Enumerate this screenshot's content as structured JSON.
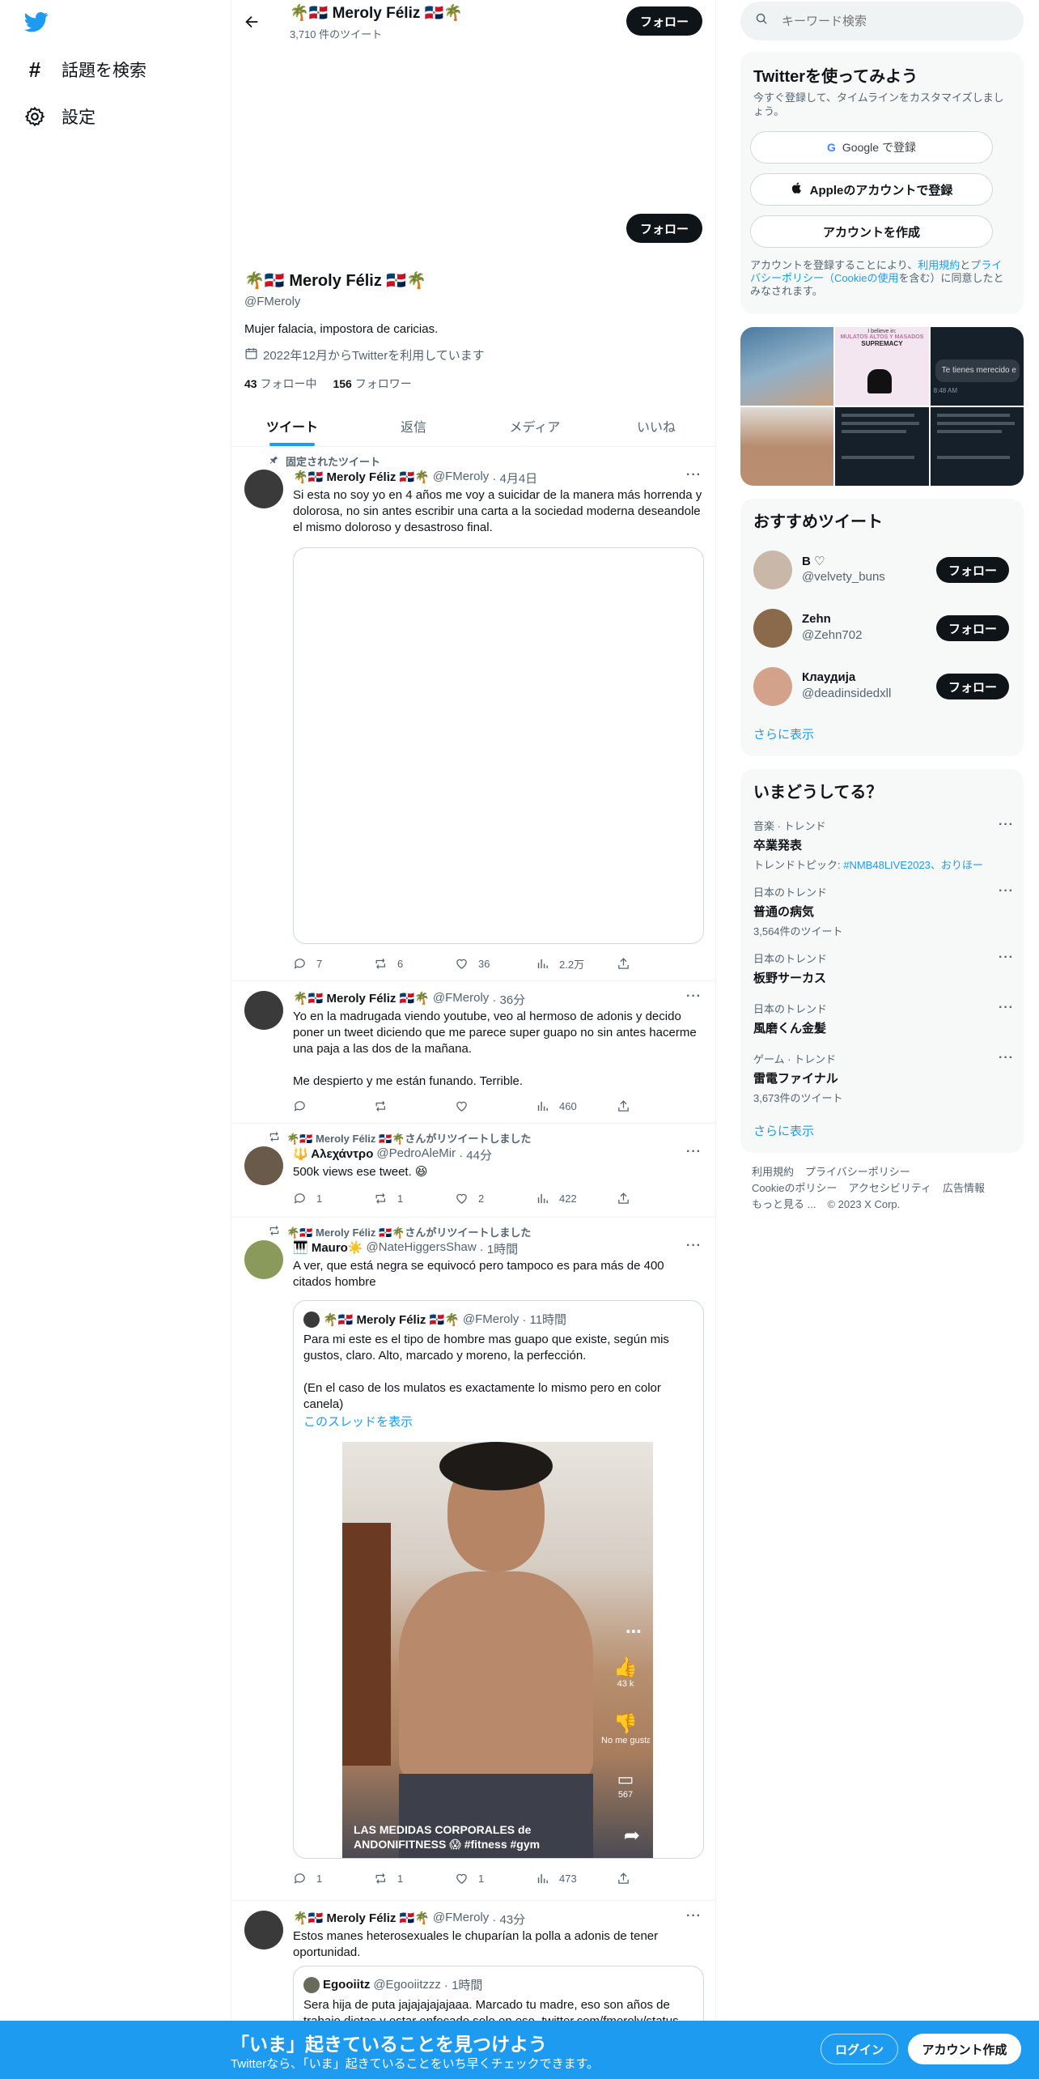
{
  "nav": {
    "explore_label": "話題を検索",
    "settings_label": "設定"
  },
  "header": {
    "name": "🌴🇩🇴 Meroly Féliz 🇩🇴🌴",
    "tweet_count": "3,710 件のツイート",
    "follow_label": "フォロー"
  },
  "profile": {
    "follow_label": "フォロー",
    "name": "🌴🇩🇴 Meroly Féliz 🇩🇴🌴",
    "handle": "@FMeroly",
    "bio": "Mujer falacia, impostora de caricias.",
    "joined": "2022年12月からTwitterを利用しています",
    "following_count": "43",
    "following_label": "フォロー中",
    "followers_count": "156",
    "followers_label": "フォロワー"
  },
  "tabs": [
    "ツイート",
    "返信",
    "メディア",
    "いいね"
  ],
  "tweets": [
    {
      "pinned_label": "固定されたツイート",
      "name": "🌴🇩🇴 Meroly Féliz 🇩🇴🌴",
      "handle": "@FMeroly",
      "time": "· 4月4日",
      "text": "Si esta no soy yo en 4 años me voy a suicidar de la manera más horrenda y dolorosa, no sin antes escribir una carta a la sociedad moderna deseandole el mismo doloroso y desastroso final.",
      "replies": "7",
      "retweets": "6",
      "likes": "36",
      "views": "2.2万"
    },
    {
      "name": "🌴🇩🇴 Meroly Féliz 🇩🇴🌴",
      "handle": "@FMeroly",
      "time": "· 36分",
      "text": "Yo en la madrugada viendo youtube, veo al hermoso de adonis y decido poner un tweet diciendo que me parece super guapo no sin antes hacerme una paja a las dos de la mañana.\n\nMe despierto y me están funando. Terrible.",
      "replies": "",
      "retweets": "",
      "likes": "",
      "views": "460"
    },
    {
      "retweet_label": "🌴🇩🇴 Meroly Féliz 🇩🇴🌴さんがリツイートしました",
      "name": "🔱 Αλεχάντρο",
      "handle": "@PedroAleMir",
      "time": "· 44分",
      "text": "500k views ese tweet. 😆",
      "replies": "1",
      "retweets": "1",
      "likes": "2",
      "views": "422"
    },
    {
      "retweet_label": "🌴🇩🇴 Meroly Féliz 🇩🇴🌴さんがリツイートしました",
      "name": "🎹 Mauro☀️",
      "handle": "@NateHiggersShaw",
      "time": "· 1時間",
      "text": "A ver, que está negra se equivocó pero tampoco es para más de 400 citados hombre",
      "quote_name": "🌴🇩🇴 Meroly Féliz 🇩🇴🌴",
      "quote_handle": "@FMeroly",
      "quote_time": "· 11時間",
      "quote_text": "Para mi este es el tipo de hombre mas guapo que existe, según mis gustos, claro. Alto, marcado y moreno, la perfección.\n\n(En el caso de los mulatos es exactamente lo mismo pero en color canela)",
      "show_thread": "このスレッドを表示",
      "video_caption": "LAS MEDIDAS CORPORALES de ANDONIFITNESS 😱 #fitness #gym",
      "video_likes": "43 k",
      "video_dislike": "No me gusta",
      "video_comments": "567",
      "replies": "1",
      "retweets": "1",
      "likes": "1",
      "views": "473"
    },
    {
      "name": "🌴🇩🇴 Meroly Féliz 🇩🇴🌴",
      "handle": "@FMeroly",
      "time": "· 43分",
      "text": "Estos manes heterosexuales le chuparían la polla a adonis de tener oportunidad.",
      "quote_name": "Egooiitz",
      "quote_handle": "@Egooiitzzz",
      "quote_time": "· 1時間",
      "quote_text": "Sera hija de puta jajajajajajaaa. Marcado tu madre, eso son años de trabajo dietas y estar enfocado solo en eso. twitter.com/fmeroly/status..."
    }
  ],
  "sidebar": {
    "search_placeholder": "キーワード検索",
    "signup": {
      "title": "Twitterを使ってみよう",
      "subtitle": "今すぐ登録して、タイムラインをカスタマイズしましょう。",
      "google_label": "Google で登録",
      "apple_label": "Appleのアカウントで登録",
      "create_label": "アカウントを作成",
      "terms_pre": "アカウントを登録することにより、",
      "terms_link1": "利用規約",
      "terms_mid": "と",
      "terms_link2": "プライバシーポリシー（Cookieの使用",
      "terms_post": "を含む）に同意したとみなされます。"
    },
    "media_texts": {
      "m2_top": "I believe in:",
      "m2_mid": "MULATOS ALTOS Y MASADOS",
      "m2_bottom": "SUPREMACY",
      "m3_text": "Te tienes merecido e",
      "m3_time": "8:48 AM"
    },
    "suggested": {
      "title": "おすすめツイート",
      "users": [
        {
          "name": "B ♡",
          "handle": "@velvety_buns",
          "follow": "フォロー"
        },
        {
          "name": "Zehn",
          "handle": "@Zehn702",
          "follow": "フォロー"
        },
        {
          "name": "Клаудија",
          "handle": "@deadinsidedxll",
          "follow": "フォロー"
        }
      ],
      "more": "さらに表示"
    },
    "trends": {
      "title": "いまどうしてる？",
      "items": [
        {
          "category": "音楽 · トレンド",
          "name": "卒業発表",
          "sub": "トレンドトピック: #NMB48LIVE2023、おりほー"
        },
        {
          "category": "日本のトレンド",
          "name": "普通の病気",
          "sub": "3,564件のツイート"
        },
        {
          "category": "日本のトレンド",
          "name": "板野サーカス",
          "sub": ""
        },
        {
          "category": "日本のトレンド",
          "name": "風磨くん金髪",
          "sub": ""
        },
        {
          "category": "ゲーム · トレンド",
          "name": "雷電ファイナル",
          "sub": "3,673件のツイート"
        }
      ],
      "more": "さらに表示"
    },
    "footer": {
      "terms": "利用規約",
      "privacy": "プライバシーポリシー",
      "cookie": "Cookieのポリシー",
      "accessibility": "アクセシビリティ",
      "ads": "広告情報",
      "more": "もっと見る ...",
      "copyright": "© 2023 X Corp."
    }
  },
  "bottom_bar": {
    "title": "「いま」起きていることを見つけよう",
    "subtitle": "Twitterなら、「いま」起きていることをいち早くチェックできます。",
    "login_label": "ログイン",
    "signup_label": "アカウント作成"
  },
  "colors": {
    "accent": "#1d9bf0",
    "text": "#0f1419",
    "muted": "#536471"
  }
}
